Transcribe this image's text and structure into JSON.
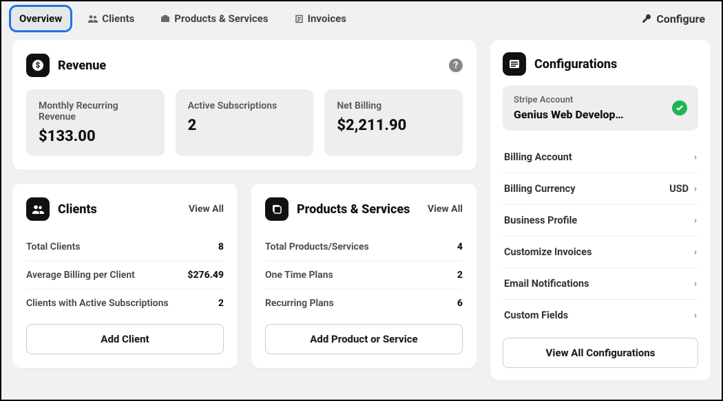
{
  "tabs": {
    "items": [
      {
        "label": "Overview",
        "active": true
      },
      {
        "label": "Clients"
      },
      {
        "label": "Products & Services"
      },
      {
        "label": "Invoices"
      }
    ],
    "configure": "Configure"
  },
  "revenue": {
    "title": "Revenue",
    "stats": [
      {
        "label": "Monthly Recurring Revenue",
        "value": "$133.00"
      },
      {
        "label": "Active Subscriptions",
        "value": "2"
      },
      {
        "label": "Net Billing",
        "value": "$2,211.90"
      }
    ]
  },
  "clients": {
    "title": "Clients",
    "viewall": "View All",
    "rows": [
      {
        "label": "Total Clients",
        "value": "8"
      },
      {
        "label": "Average Billing per Client",
        "value": "$276.49"
      },
      {
        "label": "Clients with Active Subscriptions",
        "value": "2"
      }
    ],
    "button": "Add Client"
  },
  "products": {
    "title": "Products & Services",
    "viewall": "View All",
    "rows": [
      {
        "label": "Total Products/Services",
        "value": "4"
      },
      {
        "label": "One Time Plans",
        "value": "2"
      },
      {
        "label": "Recurring Plans",
        "value": "6"
      }
    ],
    "button": "Add Product or Service"
  },
  "config": {
    "title": "Configurations",
    "stripe_label": "Stripe Account",
    "stripe_value": "Genius Web Develop…",
    "items": [
      {
        "label": "Billing Account",
        "value": ""
      },
      {
        "label": "Billing Currency",
        "value": "USD"
      },
      {
        "label": "Business Profile",
        "value": ""
      },
      {
        "label": "Customize Invoices",
        "value": ""
      },
      {
        "label": "Email Notifications",
        "value": ""
      },
      {
        "label": "Custom Fields",
        "value": ""
      }
    ],
    "button": "View All Configurations"
  }
}
